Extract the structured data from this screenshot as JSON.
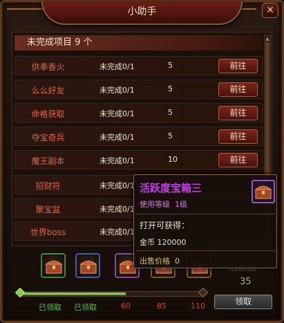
{
  "window": {
    "title": "小助手",
    "close_label": "✕"
  },
  "header": {
    "label": "未完成项目",
    "count": "9 个"
  },
  "tasks": [
    {
      "name": "供奉香火",
      "status": "未完成0/1",
      "count": "5",
      "action": "前往"
    },
    {
      "name": "么么好友",
      "status": "未完成0/1",
      "count": "5",
      "action": "前往"
    },
    {
      "name": "命格获取",
      "status": "未完成0/1",
      "count": "5",
      "action": "前往"
    },
    {
      "name": "夺宝奇兵",
      "status": "未完成0/1",
      "count": "5",
      "action": "前往"
    },
    {
      "name": "魔王副本",
      "status": "未完成0/1",
      "count": "10",
      "action": "前往"
    },
    {
      "name": "招财符",
      "status": "未完成0/1",
      "count": "",
      "action": ""
    },
    {
      "name": "聚宝盆",
      "status": "未完成0/1",
      "count": "",
      "action": ""
    },
    {
      "name": "世界boss",
      "status": "未完成0/1",
      "count": "",
      "action": ""
    }
  ],
  "activity": {
    "label": "活跃度",
    "value": "35",
    "progress_fraction": 0.58
  },
  "milestones": [
    {
      "text": "已领取",
      "done": true
    },
    {
      "text": "已领取",
      "done": true
    },
    {
      "text": "60",
      "done": false
    },
    {
      "text": "85",
      "done": false
    },
    {
      "text": "110",
      "done": false
    }
  ],
  "claim_button": "领取",
  "tooltip": {
    "name": "活跃度宝箱三",
    "level_label": "使用等级",
    "level_value": "1级",
    "obtain_label": "打开可获得：",
    "reward": "金币 120000",
    "price_label": "出售价格",
    "price_value": "0"
  },
  "colors": {
    "task_name": "#e7603f",
    "done": "#57c23b",
    "milestone": "#e23b2b",
    "tooltip_name": "#c53cf0"
  }
}
